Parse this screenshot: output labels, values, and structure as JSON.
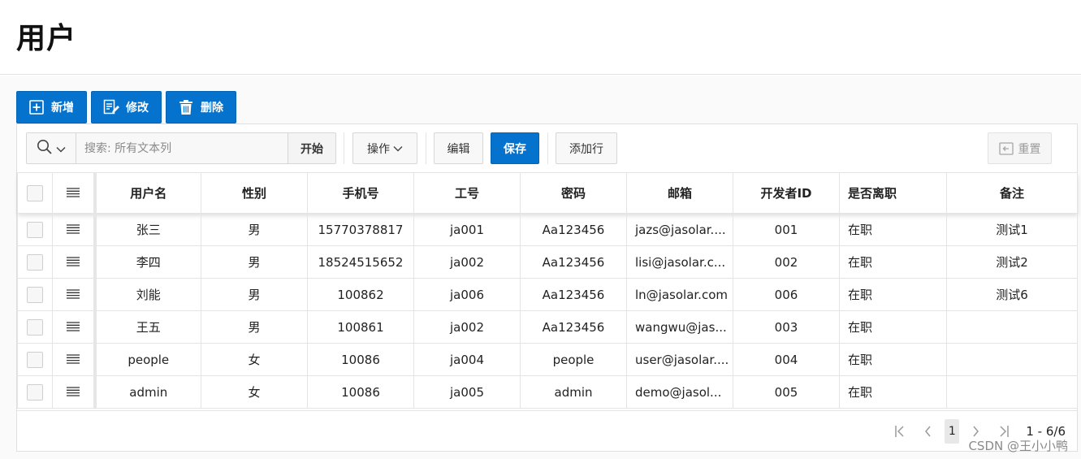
{
  "page": {
    "title": "用户"
  },
  "actions": [
    {
      "label": "新增",
      "icon": "plus-square-icon"
    },
    {
      "label": "修改",
      "icon": "edit-icon"
    },
    {
      "label": "删除",
      "icon": "trash-icon"
    }
  ],
  "toolbar": {
    "search_placeholder": "搜索: 所有文本列",
    "go_label": "开始",
    "actions_menu_label": "操作",
    "edit_label": "编辑",
    "save_label": "保存",
    "add_row_label": "添加行",
    "reset_label": "重置"
  },
  "table": {
    "columns": [
      "用户名",
      "性别",
      "手机号",
      "工号",
      "密码",
      "邮箱",
      "开发者ID",
      "是否离职",
      "备注"
    ],
    "rows": [
      {
        "username": "张三",
        "gender": "男",
        "phone": "15770378817",
        "emp_no": "ja001",
        "password": "Aa123456",
        "email": "jazs@jasolar....",
        "dev_id": "001",
        "status": "在职",
        "note": "测试1"
      },
      {
        "username": "李四",
        "gender": "男",
        "phone": "18524515652",
        "emp_no": "ja002",
        "password": "Aa123456",
        "email": "lisi@jasolar.c...",
        "dev_id": "002",
        "status": "在职",
        "note": "测试2"
      },
      {
        "username": "刘能",
        "gender": "男",
        "phone": "100862",
        "emp_no": "ja006",
        "password": "Aa123456",
        "email": "ln@jasolar.com",
        "dev_id": "006",
        "status": "在职",
        "note": "测试6"
      },
      {
        "username": "王五",
        "gender": "男",
        "phone": "100861",
        "emp_no": "ja002",
        "password": "Aa123456",
        "email": "wangwu@jas...",
        "dev_id": "003",
        "status": "在职",
        "note": ""
      },
      {
        "username": "people",
        "gender": "女",
        "phone": "10086",
        "emp_no": "ja004",
        "password": "people",
        "email": "user@jasolar....",
        "dev_id": "004",
        "status": "在职",
        "note": ""
      },
      {
        "username": "admin",
        "gender": "女",
        "phone": "10086",
        "emp_no": "ja005",
        "password": "admin",
        "email": "demo@jasol...",
        "dev_id": "005",
        "status": "在职",
        "note": ""
      }
    ]
  },
  "pagination": {
    "current_page": "1",
    "range": "1 - 6/6"
  },
  "watermark": "CSDN @王小小鸭",
  "colors": {
    "primary": "#0572ce",
    "border": "#e4e4e4"
  }
}
